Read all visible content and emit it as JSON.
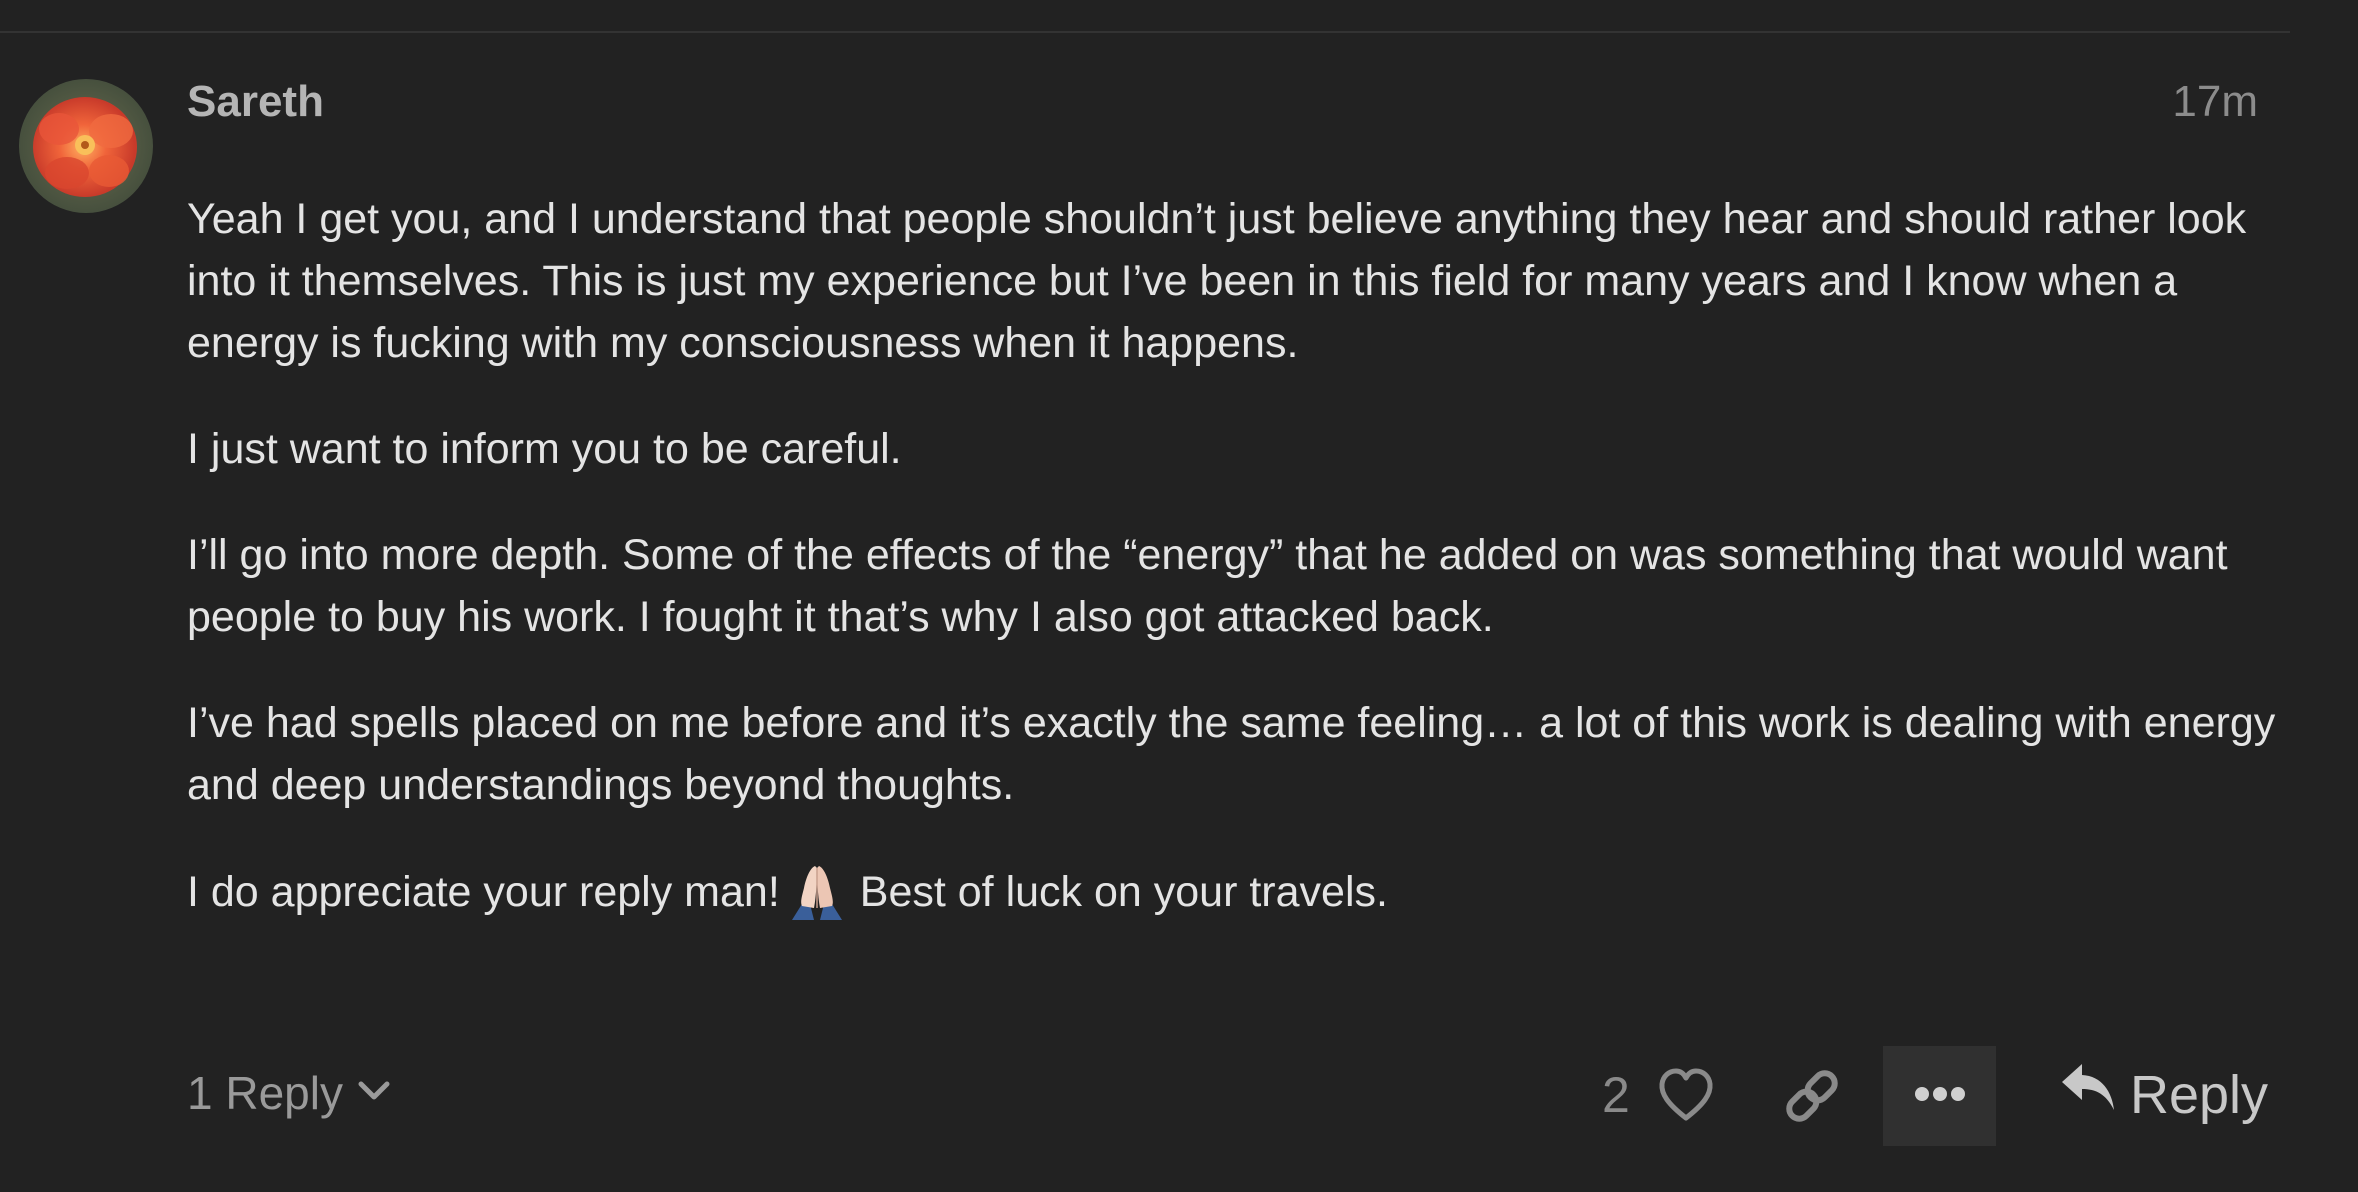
{
  "post": {
    "username": "Sareth",
    "timestamp": "17m",
    "paragraphs": [
      "Yeah I get you, and I understand that people shouldn’t just believe anything they hear and should rather look into it themselves. This is just my experience but I’ve been in this field for many years and I know when a energy is fucking with my consciousness when it happens.",
      "I just want to inform you to be careful.",
      "I’ll go into more depth. Some of the effects of the “energy” that he added on was something that would want people to buy his work. I fought it that’s why I also got attacked back.",
      "I’ve had spells placed on me before and it’s exactly the same feeling… a lot of this work is dealing with energy and deep understandings beyond thoughts."
    ],
    "last_paragraph": {
      "before_emoji": "I do appreciate your reply man!",
      "emoji": "folded-hands-emoji",
      "after_emoji": "Best of luck on your travels."
    }
  },
  "controls": {
    "replies_label": "1 Reply",
    "like_count": "2",
    "reply_label": "Reply",
    "icons": {
      "chevron": "chevron-down-icon",
      "like": "heart-icon",
      "link": "link-icon",
      "more": "ellipsis-icon",
      "reply": "reply-arrow-icon"
    }
  },
  "colors": {
    "background": "#222222",
    "text": "#e4e4e4",
    "muted": "#8c8c8c",
    "button_bg": "#303030"
  }
}
